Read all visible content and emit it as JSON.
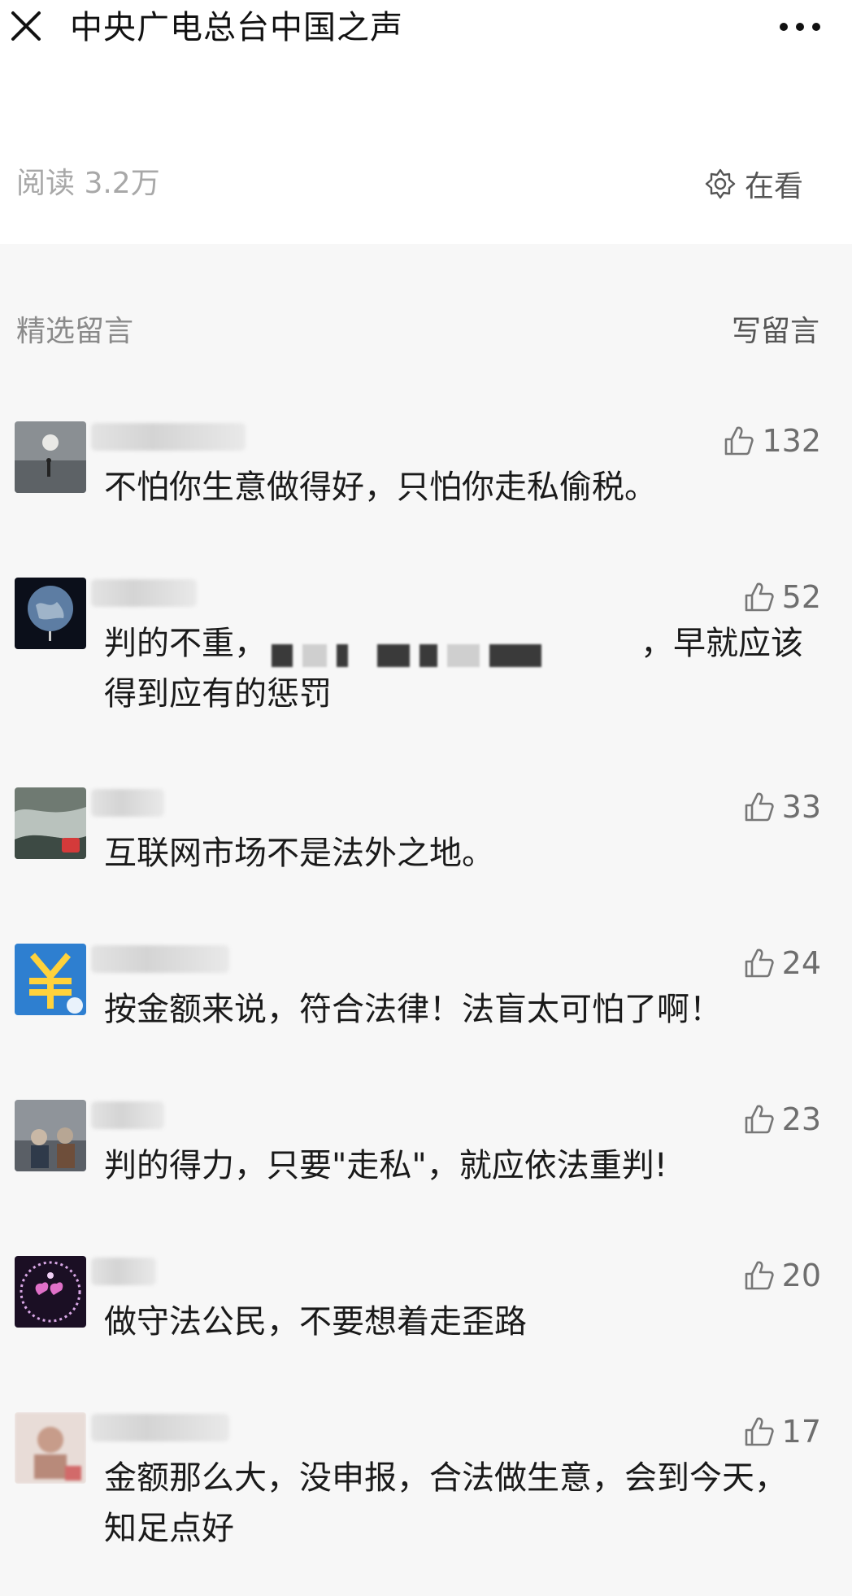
{
  "header": {
    "title": "中央广电总台中国之声"
  },
  "article_footer": {
    "read_count": "阅读 3.2万",
    "zaikan_label": "在看"
  },
  "comments_section": {
    "title": "精选留言",
    "write_label": "写留言"
  },
  "comments": [
    {
      "likes": "132",
      "text": "不怕你生意做得好，只怕你走私偷税。"
    },
    {
      "likes": "52",
      "text_before": "判的不重，",
      "text_after": "，早就应该得到应有的惩罚"
    },
    {
      "likes": "33",
      "text": "互联网市场不是法外之地。"
    },
    {
      "likes": "24",
      "text": "按金额来说，符合法律！法盲太可怕了啊！"
    },
    {
      "likes": "23",
      "text": "判的得力，只要\"走私\"，就应依法重判!"
    },
    {
      "likes": "20",
      "text": "做守法公民，不要想着走歪路"
    },
    {
      "likes": "17",
      "text": "金额那么大，没申报，合法做生意，会到今天，知足点好"
    }
  ]
}
